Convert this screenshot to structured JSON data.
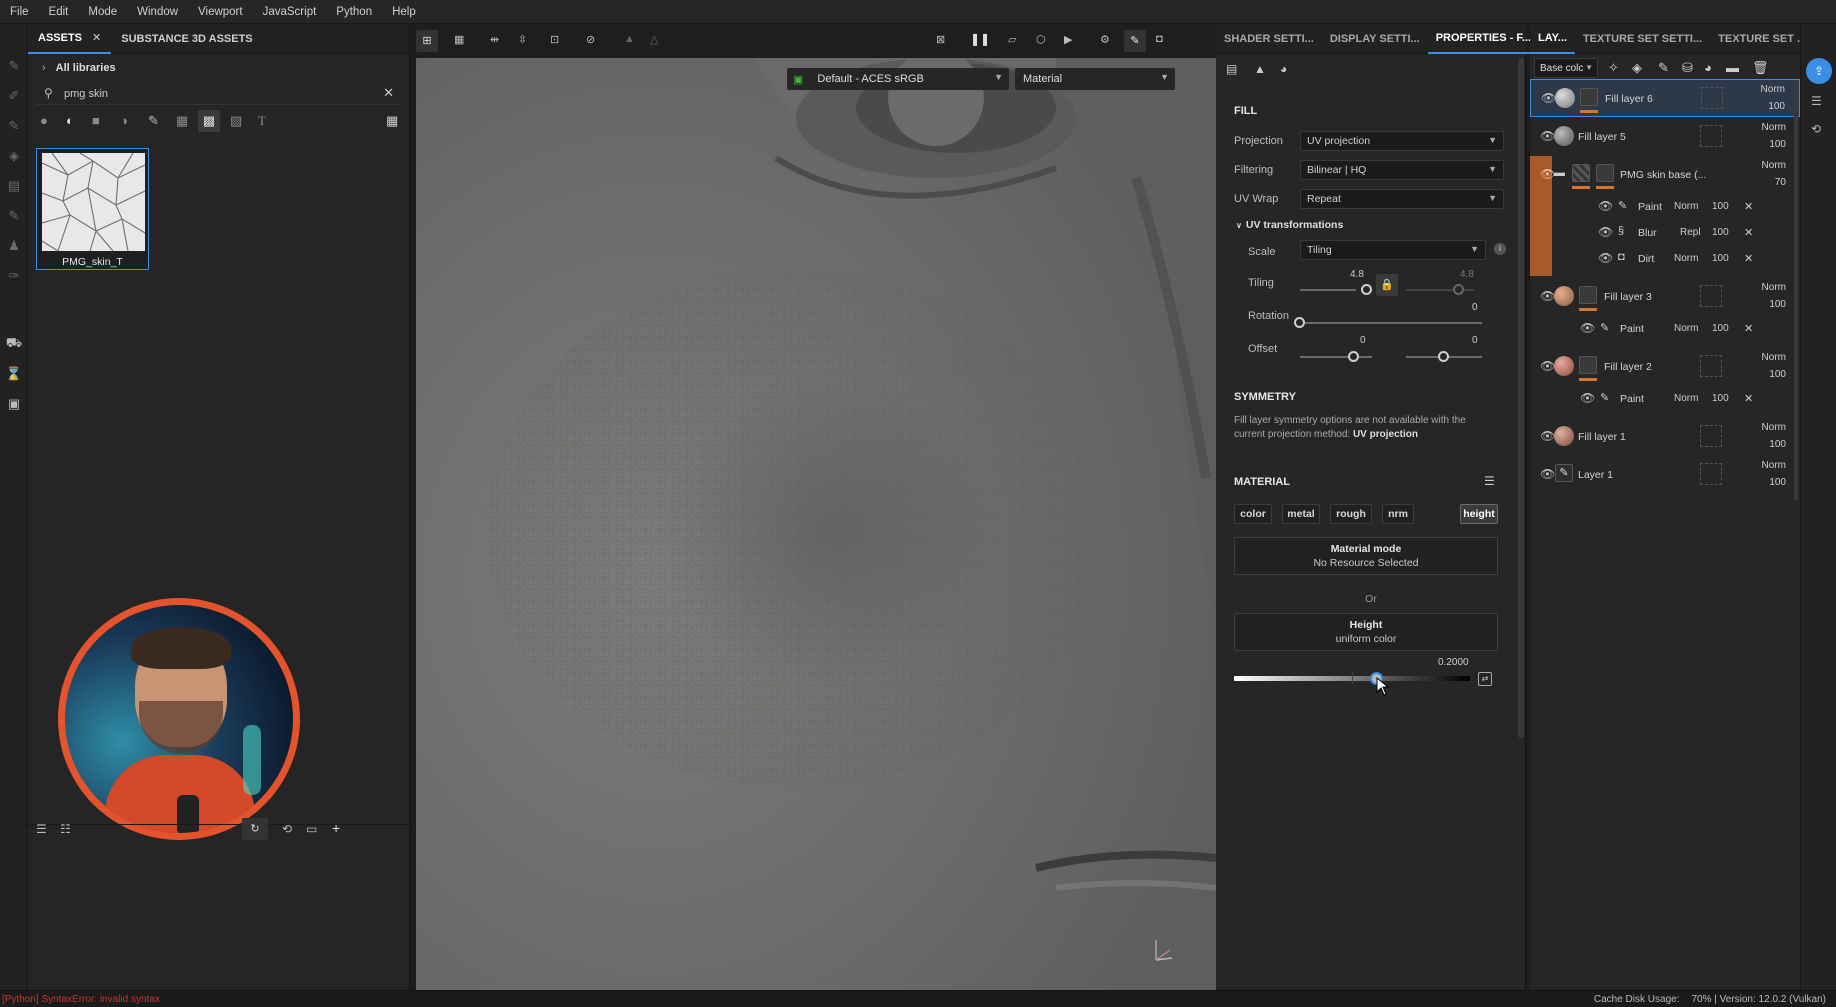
{
  "menu": [
    "File",
    "Edit",
    "Mode",
    "Window",
    "Viewport",
    "JavaScript",
    "Python",
    "Help"
  ],
  "assets": {
    "tabs": [
      "ASSETS",
      "SUBSTANCE 3D ASSETS"
    ],
    "library": "All libraries",
    "search_value": "pmg skin",
    "item_label": "PMG_skin_T"
  },
  "viewport": {
    "colorspace": "Default - ACES sRGB",
    "mode": "Material"
  },
  "properties": {
    "tabs": [
      "SHADER SETTI...",
      "DISPLAY SETTI...",
      "PROPERTIES - F..."
    ],
    "fill_title": "FILL",
    "projection_label": "Projection",
    "projection_value": "UV projection",
    "filtering_label": "Filtering",
    "filtering_value": "Bilinear | HQ",
    "uvwrap_label": "UV Wrap",
    "uvwrap_value": "Repeat",
    "uv_transform_title": "UV transformations",
    "scale_label": "Scale",
    "scale_value": "Tiling",
    "tiling_label": "Tiling",
    "tiling_value_1": "4.8",
    "tiling_value_2": "4.8",
    "tiling_fraction": 0.48,
    "rotation_label": "Rotation",
    "rotation_value": "0",
    "rotation_fraction": 0.0,
    "offset_label": "Offset",
    "offset_value_1": "0",
    "offset_value_2": "0",
    "offset_fraction": 0.5,
    "symmetry_title": "SYMMETRY",
    "symmetry_text_1": "Fill layer symmetry options are not available with the",
    "symmetry_text_2": "current projection method:",
    "symmetry_text_bold": "UV projection",
    "material_title": "MATERIAL",
    "channels": [
      "color",
      "metal",
      "rough",
      "nrm",
      "height"
    ],
    "material_mode_title": "Material mode",
    "material_mode_sub": "No Resource Selected",
    "or_text": "Or",
    "height_title": "Height",
    "height_sub": "uniform color",
    "height_value": "0.2000",
    "height_fraction": 0.6
  },
  "layers": {
    "tabs": [
      "LAY...",
      "TEXTURE SET SETTI...",
      "TEXTURE SET ..."
    ],
    "channel_select": "Base colc",
    "rows": [
      {
        "name": "Fill layer 6",
        "blend": "Norm",
        "opacity": "100"
      },
      {
        "name": "Fill layer 5",
        "blend": "Norm",
        "opacity": "100"
      },
      {
        "name": "PMG skin base (...",
        "blend": "Norm",
        "opacity": "70"
      },
      {
        "name": "Paint",
        "blend": "Norm",
        "opacity": "100"
      },
      {
        "name": "Blur",
        "blend": "Repl",
        "opacity": "100"
      },
      {
        "name": "Dirt",
        "blend": "Norm",
        "opacity": "100"
      },
      {
        "name": "Fill layer 3",
        "blend": "Norm",
        "opacity": "100"
      },
      {
        "name": "Paint",
        "blend": "Norm",
        "opacity": "100"
      },
      {
        "name": "Fill layer 2",
        "blend": "Norm",
        "opacity": "100"
      },
      {
        "name": "Paint",
        "blend": "Norm",
        "opacity": "100"
      },
      {
        "name": "Fill layer 1",
        "blend": "Norm",
        "opacity": "100"
      },
      {
        "name": "Layer 1",
        "blend": "Norm",
        "opacity": "100"
      }
    ]
  },
  "status": {
    "error": "[Python] SyntaxError: invalid syntax",
    "cache_label": "Cache Disk Usage:",
    "cache_value": "70% | Version: 12.0.2 (Vulkan)"
  },
  "colors": {
    "accent": "#3a8ee6",
    "layer_orange": "#d9742e",
    "error": "#c0392b"
  }
}
